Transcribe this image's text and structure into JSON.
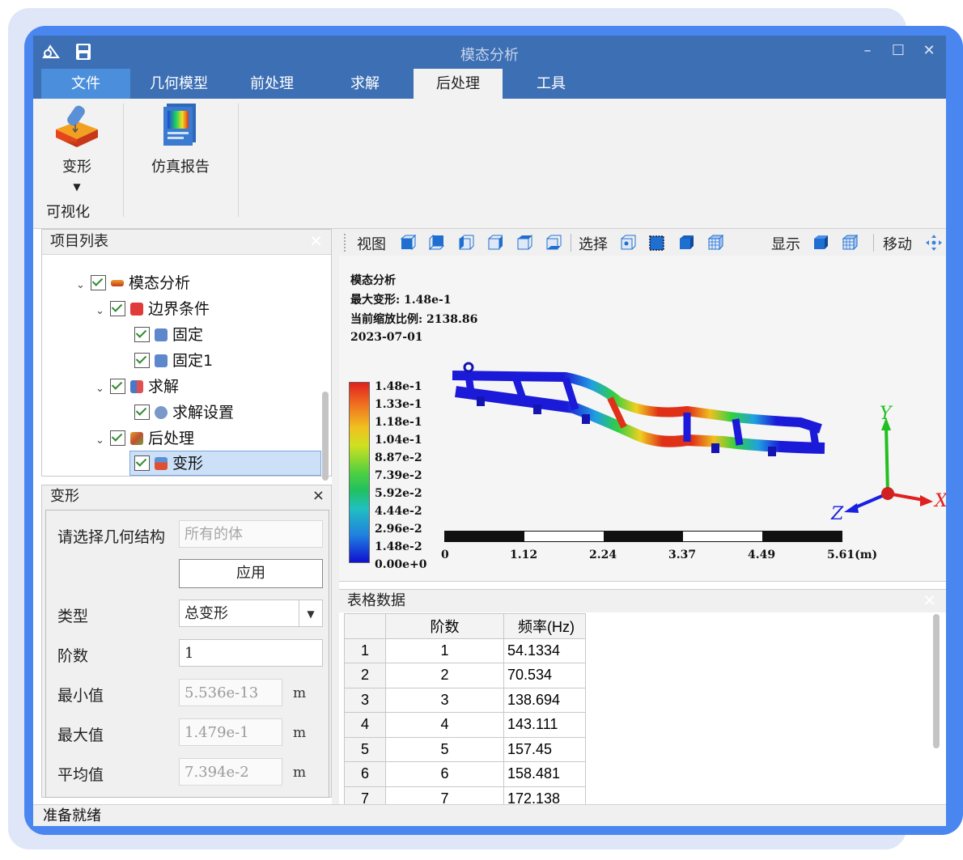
{
  "window": {
    "title": "模态分析"
  },
  "menu": {
    "items": [
      "文件",
      "几何模型",
      "前处理",
      "求解",
      "后处理",
      "工具"
    ]
  },
  "ribbon": {
    "deform_label": "变形",
    "report_label": "仿真报告",
    "group_label": "可视化"
  },
  "project_panel": {
    "title": "项目列表",
    "tree": {
      "root": "模态分析",
      "boundary": "边界条件",
      "fixed1": "固定",
      "fixed2": "固定1",
      "solve": "求解",
      "solve_settings": "求解设置",
      "post": "后处理",
      "deform": "变形"
    }
  },
  "deform_panel": {
    "title": "变形",
    "close": "×",
    "geometry_label": "请选择几何结构",
    "geometry_value": "所有的体",
    "apply_label": "应用",
    "type_label": "类型",
    "type_value": "总变形",
    "order_label": "阶数",
    "order_value": "1",
    "min_label": "最小值",
    "min_value": "5.536e-13",
    "max_label": "最大值",
    "max_value": "1.479e-1",
    "avg_label": "平均值",
    "avg_value": "7.394e-2",
    "unit": "m"
  },
  "view_toolbar": {
    "view_label": "视图",
    "select_label": "选择",
    "display_label": "显示",
    "move_label": "移动"
  },
  "viewport": {
    "info": {
      "title": "模态分析",
      "max_deform": "最大变形: 1.48e-1",
      "scale": "当前缩放比例: 2138.86",
      "date": "2023-07-01"
    },
    "legend": [
      "1.48e-1",
      "1.33e-1",
      "1.18e-1",
      "1.04e-1",
      "8.87e-2",
      "7.39e-2",
      "5.92e-2",
      "4.44e-2",
      "2.96e-2",
      "1.48e-2",
      "0.00e+0"
    ],
    "scale_bar": [
      "0",
      "1.12",
      "2.24",
      "3.37",
      "4.49",
      "5.61(m)"
    ],
    "axes": {
      "x": "X",
      "y": "Y",
      "z": "Z"
    }
  },
  "table_panel": {
    "title": "表格数据",
    "headers": [
      "",
      "阶数",
      "频率(Hz)"
    ],
    "rows": [
      [
        "1",
        "1",
        "54.1334"
      ],
      [
        "2",
        "2",
        "70.534"
      ],
      [
        "3",
        "3",
        "138.694"
      ],
      [
        "4",
        "4",
        "143.111"
      ],
      [
        "5",
        "5",
        "157.45"
      ],
      [
        "6",
        "6",
        "158.481"
      ],
      [
        "7",
        "7",
        "172.138"
      ]
    ]
  },
  "status": {
    "text": "准备就绪"
  },
  "colors": {
    "accent": "#4a86f0",
    "titlebar": "#3d6fb4",
    "active_tab": "#4b8fdc",
    "selection": "#cce0f7"
  }
}
